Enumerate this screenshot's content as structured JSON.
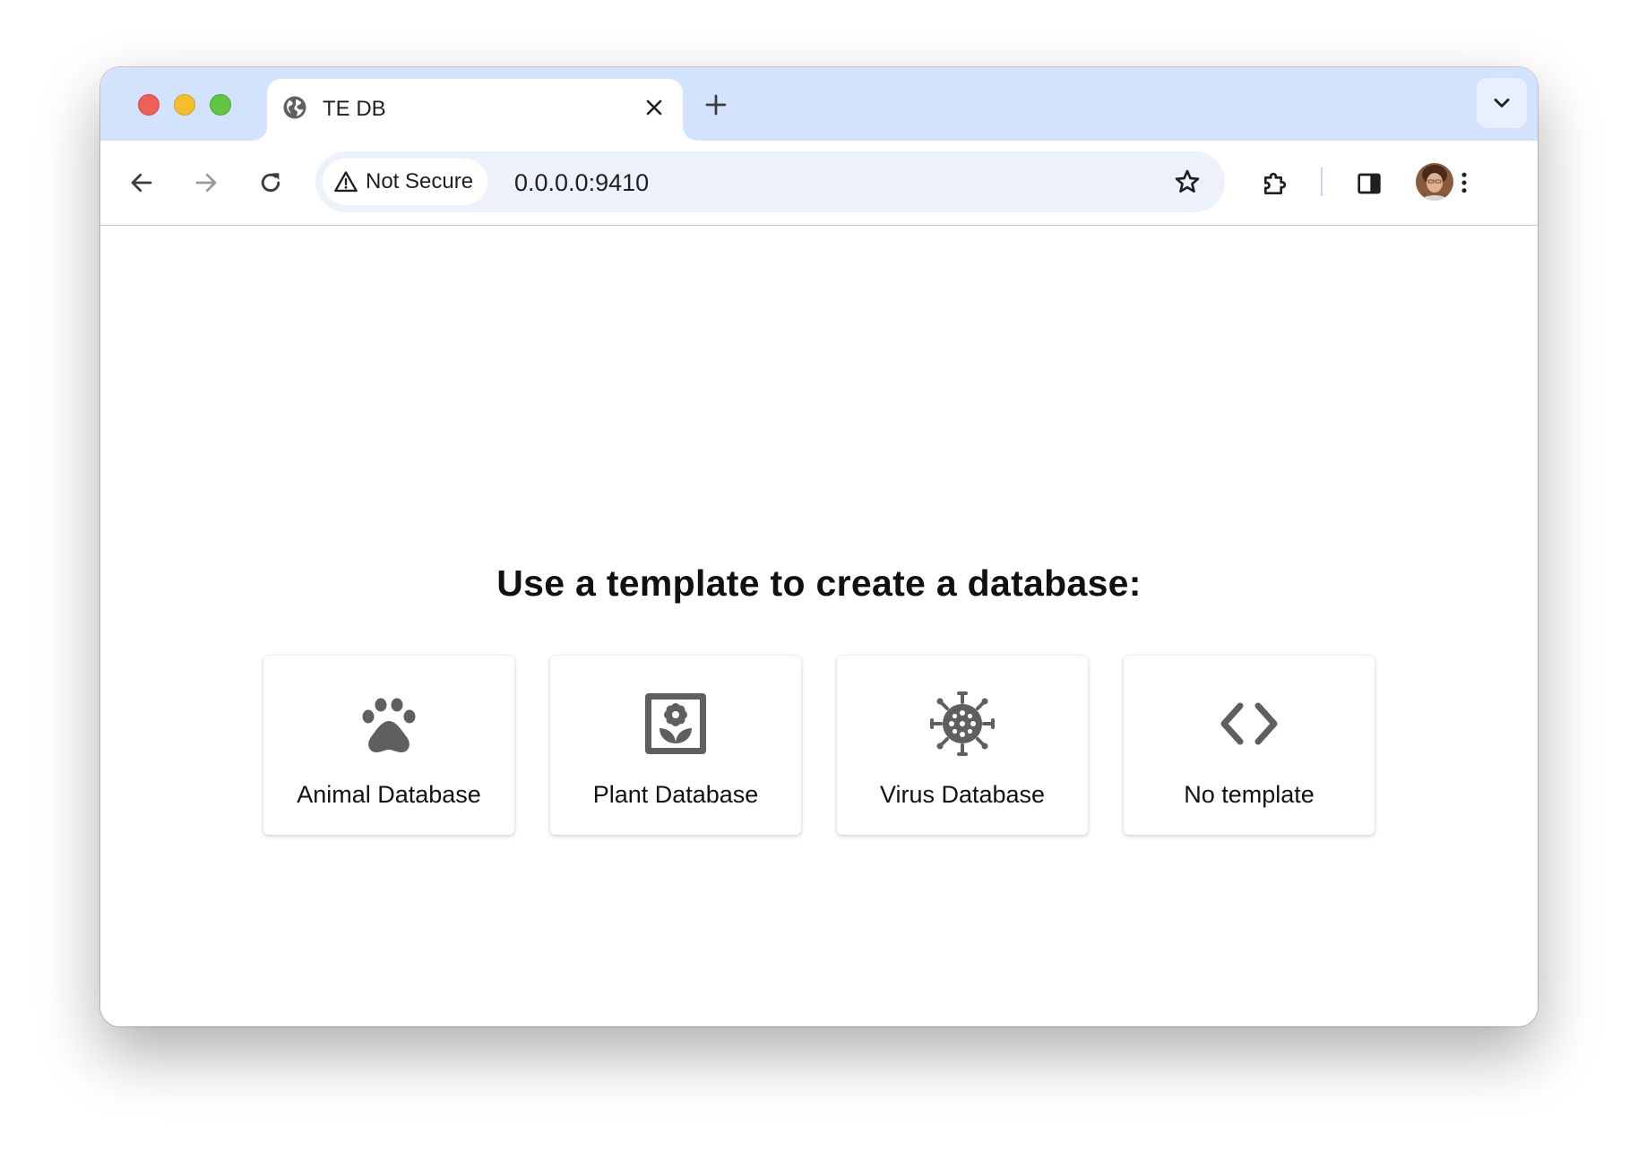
{
  "browser": {
    "tab": {
      "title": "TE DB",
      "favicon": "globe-icon"
    },
    "address_bar": {
      "security_label": "Not Secure",
      "url": "0.0.0.0:9410"
    },
    "icons": {
      "back": "arrow-left-icon",
      "forward": "arrow-right-icon",
      "reload": "reload-icon",
      "bookmark": "star-icon",
      "extensions": "puzzle-icon",
      "side_panel": "side-panel-icon",
      "menu": "kebab-menu-icon",
      "tab_search": "chevron-down-icon",
      "new_tab": "plus-icon",
      "close_tab": "close-icon"
    },
    "colors": {
      "titlebar": "#d3e3fd",
      "omnibox": "#edf2fa",
      "icon": "#5f5f5f"
    }
  },
  "page": {
    "heading": "Use a template to create a database:",
    "templates": [
      {
        "label": "Animal Database",
        "icon": "paw-icon"
      },
      {
        "label": "Plant Database",
        "icon": "flower-frame-icon"
      },
      {
        "label": "Virus Database",
        "icon": "virus-icon"
      },
      {
        "label": "No template",
        "icon": "code-icon"
      }
    ]
  }
}
